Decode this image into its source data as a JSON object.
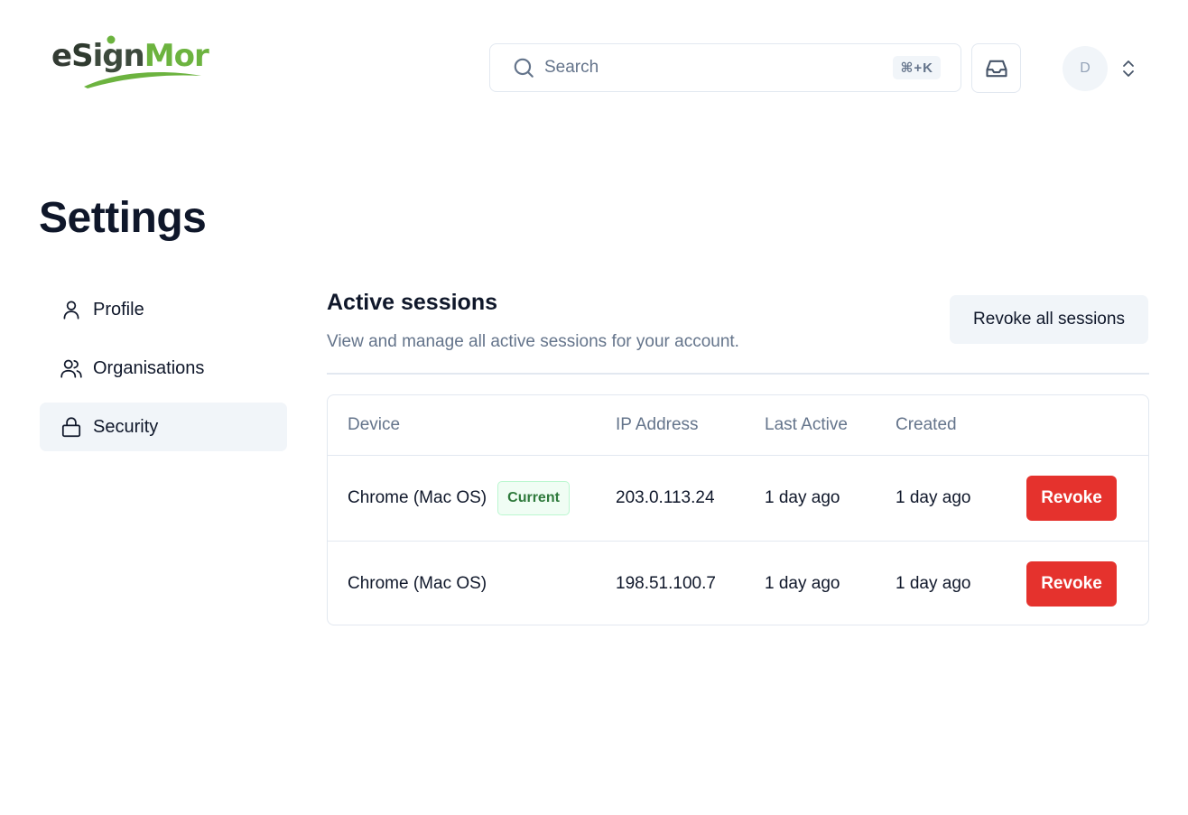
{
  "header": {
    "logo": {
      "part_e": "e",
      "part_s": "S",
      "part_ign": "ign",
      "part_mor": "Mor",
      "brand_green": "#6cb33f"
    },
    "search": {
      "placeholder": "Search",
      "shortcut": "⌘+K",
      "icon": "search-icon"
    },
    "inbox_icon": "inbox-icon",
    "avatar": {
      "initial": "D"
    }
  },
  "page": {
    "title": "Settings"
  },
  "sidebar": {
    "items": [
      {
        "label": "Profile",
        "icon": "user-icon",
        "active": false
      },
      {
        "label": "Organisations",
        "icon": "users-icon",
        "active": false
      },
      {
        "label": "Security",
        "icon": "lock-icon",
        "active": true
      }
    ]
  },
  "sessions": {
    "title": "Active sessions",
    "description": "View and manage all active sessions for your account.",
    "revoke_all_label": "Revoke all sessions",
    "columns": [
      "Device",
      "IP Address",
      "Last Active",
      "Created"
    ],
    "rows": [
      {
        "device": "Chrome (Mac OS)",
        "badge": "Current",
        "ip": "203.0.113.24",
        "last_active": "1 day ago",
        "created": "1 day ago",
        "action": "Revoke"
      },
      {
        "device": "Chrome (Mac OS)",
        "badge": "",
        "ip": "198.51.100.7",
        "last_active": "1 day ago",
        "created": "1 day ago",
        "action": "Revoke"
      }
    ]
  },
  "colors": {
    "danger": "#e5322d",
    "muted_text": "#64748b",
    "active_bg": "#f1f5f9"
  }
}
